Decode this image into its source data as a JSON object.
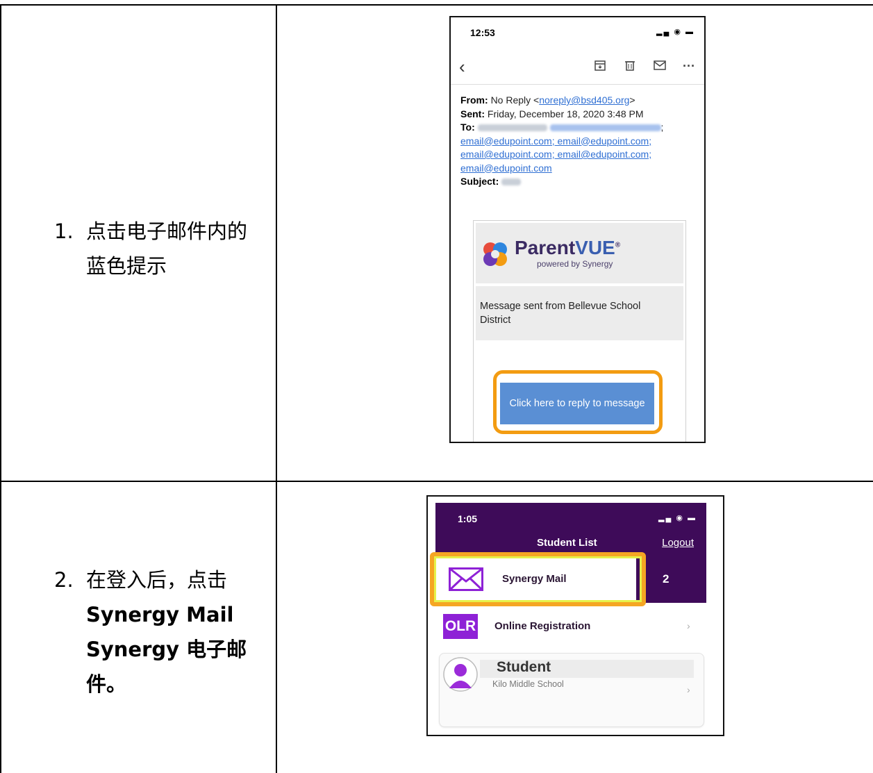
{
  "rows": [
    {
      "number": "1.",
      "text": "点击电子邮件内的蓝色提示"
    },
    {
      "number": "2.",
      "text_prefix": "在登入后，点击",
      "text_bold": "Synergy Mail Synergy 电子邮件。"
    }
  ],
  "email_screen": {
    "time": "12:53",
    "status_icons": "▂▄ ◉ ▬",
    "back_icon": "chevron-left",
    "toolbar_icons": [
      "archive",
      "trash",
      "mail",
      "more"
    ],
    "from_label": "From:",
    "from_name": "No Reply <",
    "from_address": "noreply@bsd405.org",
    "from_close": ">",
    "sent_label": "Sent:",
    "sent_value": "Friday, December 18, 2020 3:48 PM",
    "to_label": "To:",
    "to_addresses_line1": "email@edupoint.com; email@edupoint.com;",
    "to_addresses_line2": "email@edupoint.com; email@edupoint.com;",
    "to_addresses_line3": "email@edupoint.com",
    "subject_label": "Subject:",
    "logo_text_a": "Parent",
    "logo_text_b": "VUE",
    "logo_mark": "®",
    "logo_sub": "powered by Synergy",
    "message": "Message sent from Bellevue School District",
    "reply_button": "Click here to reply to message",
    "accent_color": "#f39c12",
    "button_color": "#5a8fd4"
  },
  "app_screen": {
    "time": "1:05",
    "status_icons": "▂▄ ◉ ▬",
    "title": "Student List",
    "logout": "Logout",
    "mail_label": "Synergy Mail",
    "mail_badge": "2",
    "olr_icon_text": "OLR",
    "olr_label": "Online Registration",
    "student_name": "Student",
    "student_school": "Kilo Middle School",
    "header_color": "#3e0b59",
    "highlight_color": "#f5a623"
  }
}
